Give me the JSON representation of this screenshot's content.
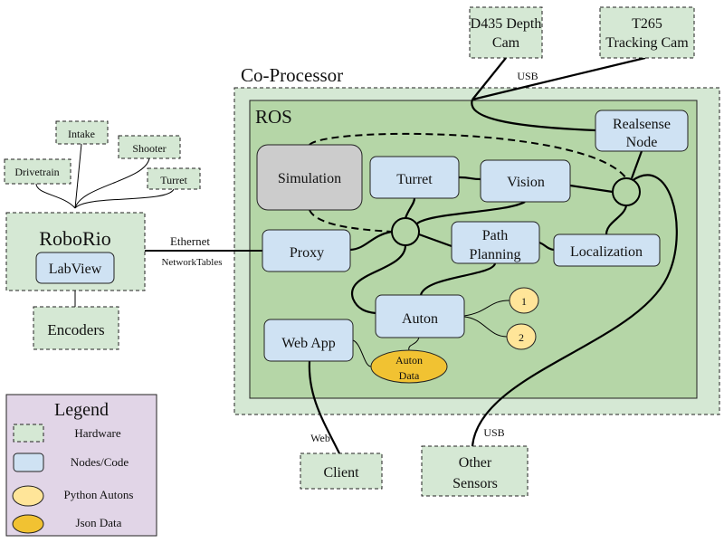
{
  "colors": {
    "hardware": "#d5e8d4",
    "ros": "#b5d6a7",
    "node": "#cfe2f3",
    "simulation": "#cccccc",
    "python_auton": "#ffe599",
    "json_data": "#f1c232",
    "legend": "#e1d5e7"
  },
  "hardware": {
    "d435_line1": "D435 Depth",
    "d435_line2": "Cam",
    "t265_line1": "T265",
    "t265_line2": "Tracking Cam",
    "drivetrain": "Drivetrain",
    "intake": "Intake",
    "shooter": "Shooter",
    "turret": "Turret",
    "roborio": "RoboRio",
    "encoders": "Encoders",
    "client": "Client",
    "other_line1": "Other",
    "other_line2": "Sensors"
  },
  "containers": {
    "coprocessor": "Co-Processor",
    "ros": "ROS"
  },
  "nodes": {
    "labview": "LabView",
    "realsense_line1": "Realsense",
    "realsense_line2": "Node",
    "simulation": "Simulation",
    "turret": "Turret",
    "vision": "Vision",
    "proxy": "Proxy",
    "path_line1": "Path",
    "path_line2": "Planning",
    "localization": "Localization",
    "auton": "Auton",
    "webapp": "Web App",
    "auton1": "1",
    "auton2": "2",
    "auton_data_line1": "Auton",
    "auton_data_line2": "Data"
  },
  "edges": {
    "ethernet": "Ethernet",
    "networktables": "NetworkTables",
    "usb_top": "USB",
    "web": "Web",
    "usb_bottom": "USB"
  },
  "legend": {
    "title": "Legend",
    "items": [
      "Hardware",
      "Nodes/Code",
      "Python Autons",
      "Json Data"
    ]
  }
}
